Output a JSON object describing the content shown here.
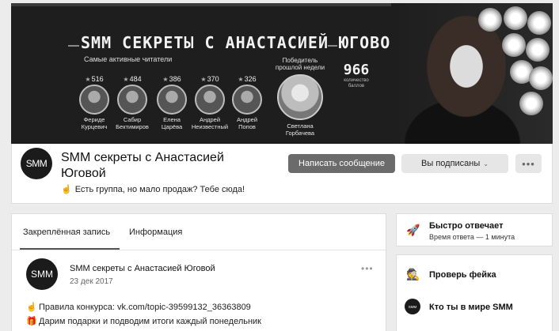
{
  "banner": {
    "title": "SMM секреты с Анастасией Юговой",
    "subtitle": "Самые активные читатели",
    "readers": [
      {
        "score": "516",
        "first": "Фериде",
        "last": "Курцевич"
      },
      {
        "score": "484",
        "first": "Сабир",
        "last": "Бектимиров"
      },
      {
        "score": "386",
        "first": "Елена",
        "last": "Царёва"
      },
      {
        "score": "370",
        "first": "Андрей",
        "last": "Неизвестный"
      },
      {
        "score": "326",
        "first": "Андрей",
        "last": "Попов"
      }
    ],
    "winner": {
      "label_1": "Победитель",
      "label_2": "прошлой недели",
      "first": "Светлана",
      "last": "Горбачева"
    },
    "points": {
      "value": "966",
      "caption_1": "количество",
      "caption_2": "баллов"
    }
  },
  "group": {
    "avatar_text": "SMM",
    "title": "SMM секреты с Анастасией Юговой",
    "status_icon": "hand-pointing-icon",
    "status": "Есть группа, но мало продаж? Тебе сюда!",
    "btn_message": "Написать сообщение",
    "btn_subscribed": "Вы подписаны",
    "btn_more": "•••"
  },
  "post": {
    "tabs": [
      "Закреплённая запись",
      "Информация"
    ],
    "author": "SMM секреты с Анастасией Юговой",
    "avatar_text": "SMM",
    "date": "23 дек 2017",
    "more": "•••",
    "line1": "Правила конкурса: vk.com/topic-39599132_36363809",
    "line2": "Дарим подарки и подводим итоги каждый понедельник"
  },
  "sidebar": {
    "fast_title": "Быстро отвечает",
    "fast_sub": "Время ответа — 1 минута",
    "app1": "Проверь фейка",
    "app2": "Кто ты в мире SMM",
    "app2_logo": "SMM"
  },
  "colors": {
    "primary_button": "#6b6b6b",
    "secondary_button": "#e6e6e6",
    "cover_bg": "#1e1e1e"
  }
}
